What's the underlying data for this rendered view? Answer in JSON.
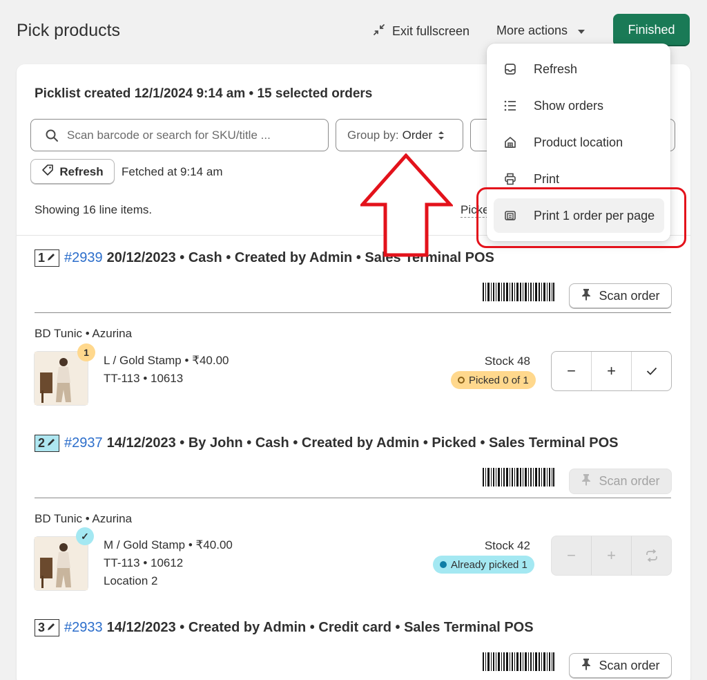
{
  "header": {
    "title": "Pick products",
    "exit_fullscreen": "Exit fullscreen",
    "more_actions": "More actions",
    "finished": "Finished"
  },
  "picklist": {
    "title": "Picklist created 12/1/2024 9:14 am • 15 selected orders",
    "search_placeholder": "Scan barcode or search for SKU/title ...",
    "groupby_label": "Group by:",
    "groupby_value": "Order",
    "refresh": "Refresh",
    "fetched": "Fetched at 9:14 am",
    "showing": "Showing 16 line items.",
    "picked_partial": "Picked"
  },
  "orders": [
    {
      "num": "1",
      "order_id": "#2939",
      "details": "20/12/2023 • Cash • Created by Admin • Sales Terminal POS",
      "scan_label": "Scan order",
      "product": "BD Tunic • Azurina",
      "variant": "L / Gold Stamp • ₹40.00",
      "sku": "TT-113 • 10613",
      "location": "",
      "qty_badge": "1",
      "stock": "Stock 48",
      "status": "Picked 0 of 1"
    },
    {
      "num": "2",
      "order_id": "#2937",
      "details": "14/12/2023 • By John • Cash • Created by Admin • Picked • Sales Terminal POS",
      "scan_label": "Scan order",
      "product": "BD Tunic • Azurina",
      "variant": "M / Gold Stamp • ₹40.00",
      "sku": "TT-113 • 10612",
      "location": "Location 2",
      "qty_badge": "✓",
      "stock": "Stock 42",
      "status": "Already picked 1"
    },
    {
      "num": "3",
      "order_id": "#2933",
      "details": "14/12/2023 • Created by Admin • Credit card • Sales Terminal POS",
      "scan_label": "Scan order"
    }
  ],
  "menu": {
    "items": [
      {
        "label": "Refresh",
        "icon": "inbox-refresh-icon"
      },
      {
        "label": "Show orders",
        "icon": "list-icon"
      },
      {
        "label": "Product location",
        "icon": "warehouse-icon"
      },
      {
        "label": "Print",
        "icon": "printer-icon"
      },
      {
        "label": "Print 1 order per page",
        "icon": "print-pages-icon"
      }
    ]
  },
  "colors": {
    "primary": "#1a7a56",
    "link": "#2c6ecb",
    "highlight": "#e3121b",
    "status_pending": "#ffd88d",
    "status_done": "#a4e8f2"
  }
}
